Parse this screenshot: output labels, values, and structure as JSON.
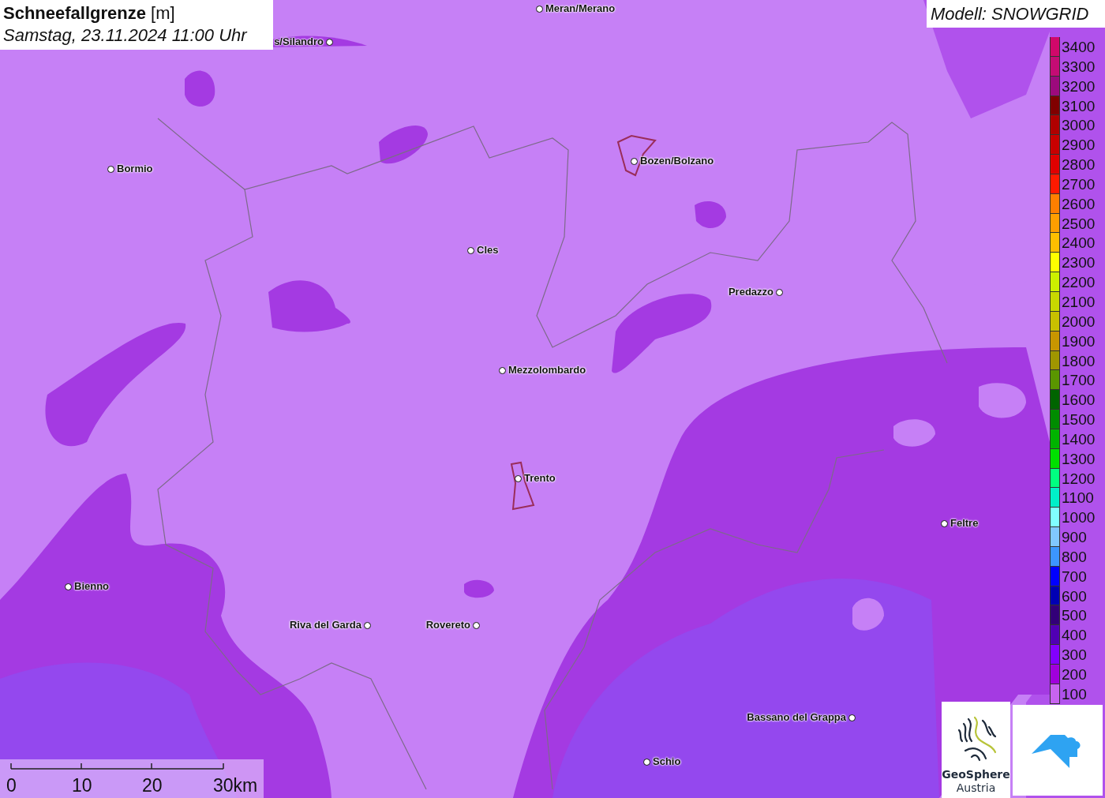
{
  "title": {
    "heading": "**Schneefallgrenze** [m]",
    "datetime": "Samstag, 23.11.2024 11:00 Uhr"
  },
  "model": "Modell: SNOWGRID",
  "legend": [
    {
      "label": "3400",
      "color": "#d1086a"
    },
    {
      "label": "3300",
      "color": "#c40c74"
    },
    {
      "label": "3200",
      "color": "#9c0a7c"
    },
    {
      "label": "3100",
      "color": "#800000"
    },
    {
      "label": "3000",
      "color": "#b00000"
    },
    {
      "label": "2900",
      "color": "#c80000"
    },
    {
      "label": "2800",
      "color": "#e00000"
    },
    {
      "label": "2700",
      "color": "#ff1a00"
    },
    {
      "label": "2600",
      "color": "#ff7f00"
    },
    {
      "label": "2500",
      "color": "#ff9f00"
    },
    {
      "label": "2400",
      "color": "#ffbf00"
    },
    {
      "label": "2300",
      "color": "#ffff00"
    },
    {
      "label": "2200",
      "color": "#ccf000"
    },
    {
      "label": "2100",
      "color": "#c8d800"
    },
    {
      "label": "2000",
      "color": "#c8c000"
    },
    {
      "label": "1900",
      "color": "#c89600"
    },
    {
      "label": "1800",
      "color": "#a09600"
    },
    {
      "label": "1700",
      "color": "#5a9600"
    },
    {
      "label": "1600",
      "color": "#006400"
    },
    {
      "label": "1500",
      "color": "#008c00"
    },
    {
      "label": "1400",
      "color": "#00b400"
    },
    {
      "label": "1300",
      "color": "#00e000"
    },
    {
      "label": "1200",
      "color": "#00ff80"
    },
    {
      "label": "1100",
      "color": "#00f0c8"
    },
    {
      "label": "1000",
      "color": "#80ffff"
    },
    {
      "label": "900",
      "color": "#80c8ff"
    },
    {
      "label": "800",
      "color": "#3c96ff"
    },
    {
      "label": "700",
      "color": "#0000ff"
    },
    {
      "label": "600",
      "color": "#0000b4"
    },
    {
      "label": "500",
      "color": "#320078"
    },
    {
      "label": "400",
      "color": "#5000b4"
    },
    {
      "label": "300",
      "color": "#8200ff"
    },
    {
      "label": "200",
      "color": "#a000dc"
    },
    {
      "label": "100",
      "color": "#c864f0"
    }
  ],
  "cities": [
    {
      "name": "Meran/Merano"
    },
    {
      "name": "s/Silandro"
    },
    {
      "name": "Bormio"
    },
    {
      "name": "Bozen/Bolzano"
    },
    {
      "name": "Cles"
    },
    {
      "name": "Predazzo"
    },
    {
      "name": "Mezzolombardo"
    },
    {
      "name": "Trento"
    },
    {
      "name": "Feltre"
    },
    {
      "name": "Bienno"
    },
    {
      "name": "Riva del Garda"
    },
    {
      "name": "Rovereto"
    },
    {
      "name": "Bassano del Grappa"
    },
    {
      "name": "Schio"
    }
  ],
  "scale": {
    "ticks": [
      "0",
      "10",
      "20",
      "30km"
    ]
  },
  "logo": {
    "line1": "GeoSphere",
    "line2": "Austria"
  }
}
